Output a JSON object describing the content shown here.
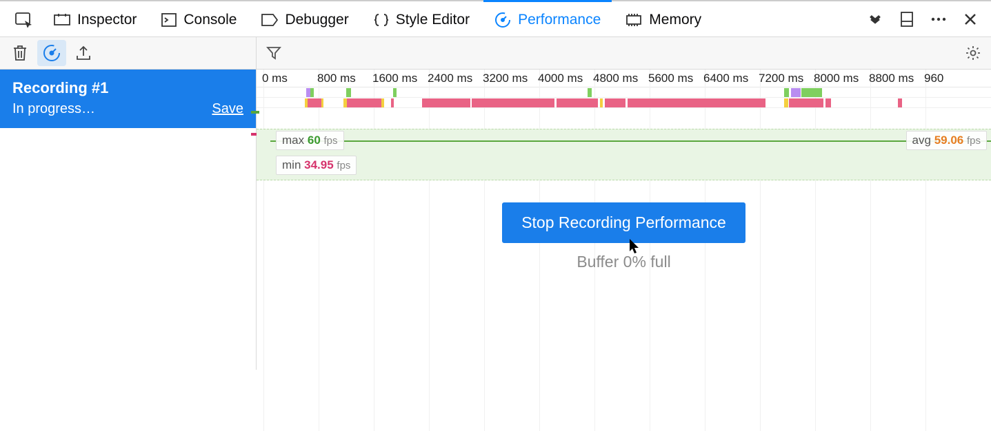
{
  "tabs": {
    "inspector": "Inspector",
    "console": "Console",
    "debugger": "Debugger",
    "style_editor": "Style Editor",
    "performance": "Performance",
    "memory": "Memory"
  },
  "sidebar": {
    "recording_title": "Recording #1",
    "recording_status": "In progress…",
    "save": "Save"
  },
  "timeline": {
    "ticks": [
      "0 ms",
      "800 ms",
      "1600 ms",
      "2400 ms",
      "3200 ms",
      "4000 ms",
      "4800 ms",
      "5600 ms",
      "6400 ms",
      "7200 ms",
      "8000 ms",
      "8800 ms",
      "960"
    ]
  },
  "fps": {
    "max_label": "max",
    "max_value": "60",
    "min_label": "min",
    "min_value": "34.95",
    "avg_label": "avg",
    "avg_value": "59.06",
    "unit": "fps"
  },
  "main": {
    "stop_button": "Stop Recording Performance",
    "buffer_status": "Buffer 0% full"
  }
}
